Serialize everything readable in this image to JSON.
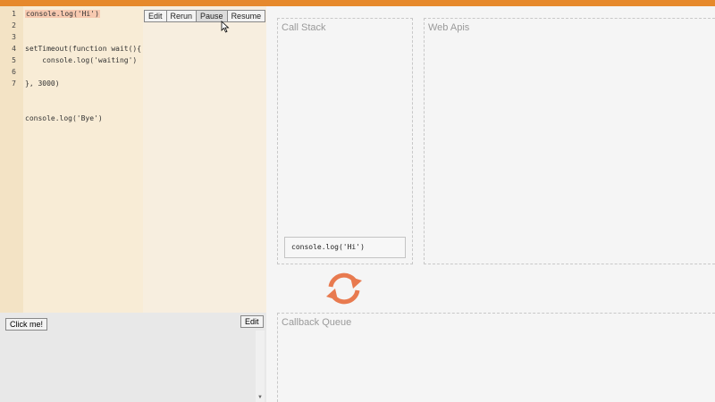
{
  "header": {
    "brand_color": "#e6892c"
  },
  "editor": {
    "line_numbers": [
      "1",
      "2",
      "3",
      "4",
      "5",
      "6",
      "7"
    ],
    "lines": [
      "console.log('Hi')",
      "",
      "",
      "setTimeout(function wait(){",
      "    console.log('waiting')",
      "",
      "}, 3000)",
      "",
      "",
      "console.log('Bye')"
    ],
    "toolbar": {
      "edit": "Edit",
      "rerun": "Rerun",
      "pause": "Pause",
      "resume": "Resume"
    }
  },
  "output": {
    "click_button": "Click me!",
    "edit_button": "Edit"
  },
  "panels": {
    "call_stack": {
      "title": "Call Stack",
      "frames": [
        "console.log('Hi')"
      ]
    },
    "web_apis": {
      "title": "Web Apis"
    },
    "callback_queue": {
      "title": "Callback Queue"
    }
  },
  "icons": {
    "event_loop": "event-loop-icon",
    "cursor": "mouse-cursor-icon"
  },
  "colors": {
    "loop_icon": "#e87a4f",
    "highlight": "#f7c9b0"
  }
}
